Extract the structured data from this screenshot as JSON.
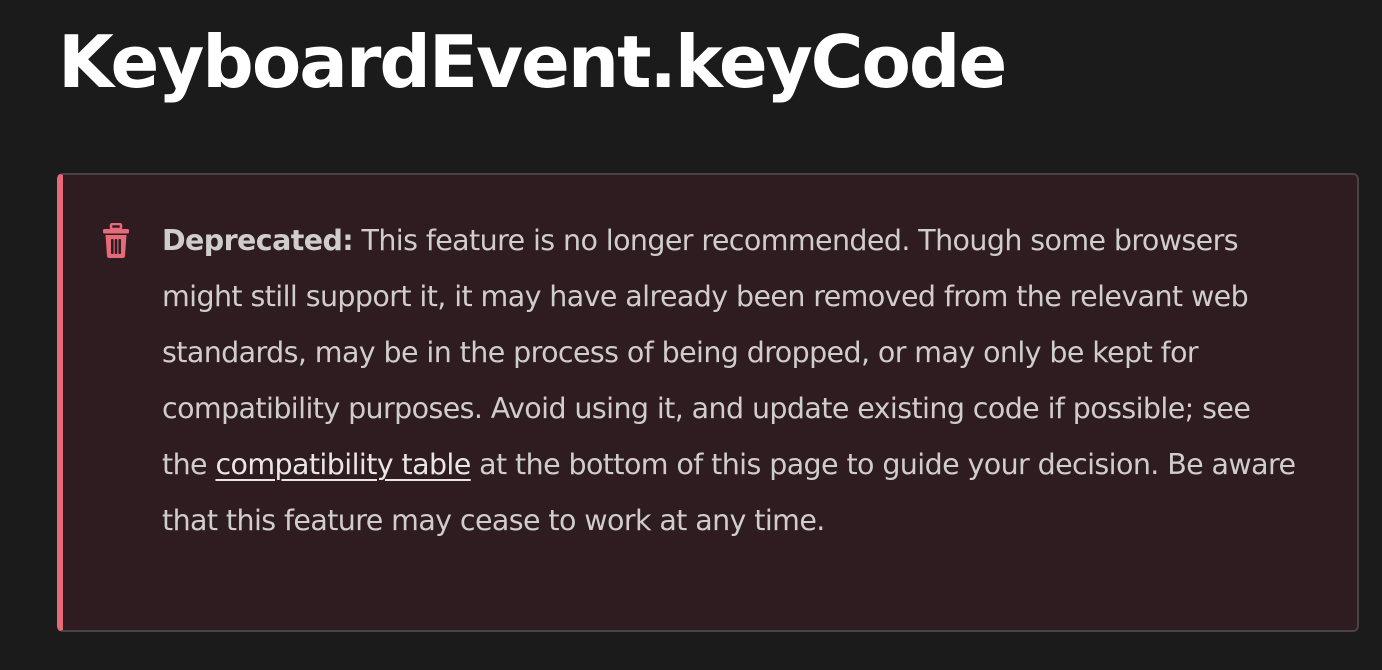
{
  "page": {
    "title": "KeyboardEvent.keyCode"
  },
  "notecard": {
    "icon": "trash-icon",
    "accent_color": "#e56b79",
    "label": "Deprecated:",
    "text_before_link": " This feature is no longer recommended. Though some browsers might still support it, it may have already been removed from the relevant web standards, may be in the process of being dropped, or may only be kept for compatibility purposes. Avoid using it, and update existing code if possible; see the ",
    "link_text": "compatibility table",
    "text_after_link": " at the bottom of this page to guide your decision. Be aware that this feature may cease to work at any time."
  }
}
